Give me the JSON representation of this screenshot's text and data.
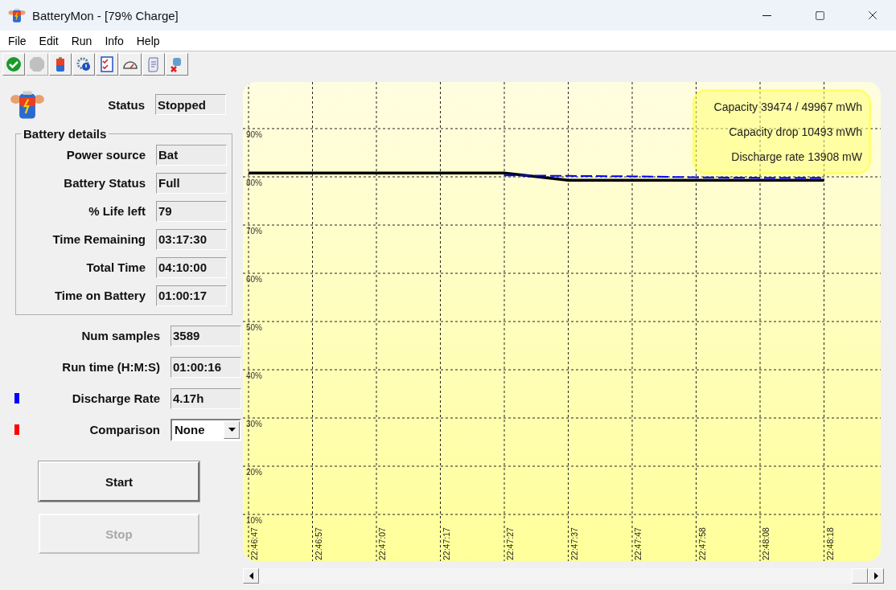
{
  "window": {
    "title": "BatteryMon - [79% Charge]"
  },
  "menu": [
    "File",
    "Edit",
    "Run",
    "Info",
    "Help"
  ],
  "toolbar": [
    {
      "kind": "start",
      "disabled": false
    },
    {
      "kind": "stop",
      "disabled": true
    },
    {
      "kind": "battery",
      "disabled": false
    },
    {
      "kind": "settings",
      "disabled": false
    },
    {
      "kind": "checklist",
      "disabled": false
    },
    {
      "kind": "gauge",
      "disabled": false
    },
    {
      "kind": "script",
      "disabled": false
    },
    {
      "kind": "tools",
      "disabled": false
    }
  ],
  "status": {
    "label": "Status",
    "value": "Stopped"
  },
  "battery_details": {
    "title": "Battery details",
    "fields": [
      {
        "label": "Power source",
        "value": "Bat"
      },
      {
        "label": "Battery Status",
        "value": "Full"
      },
      {
        "label": "% Life left",
        "value": "79"
      },
      {
        "label": "Time Remaining",
        "value": "03:17:30"
      },
      {
        "label": "Total Time",
        "value": "04:10:00"
      },
      {
        "label": "Time on Battery",
        "value": "01:00:17"
      }
    ]
  },
  "stats": [
    {
      "kind": "field",
      "label": "Num samples",
      "value": "3589"
    },
    {
      "kind": "field",
      "label": "Run time (H:M:S)",
      "value": "01:00:16"
    },
    {
      "kind": "field",
      "label": "Discharge Rate",
      "value": "4.17h",
      "color": "#0000ff"
    },
    {
      "kind": "dropdown",
      "label": "Comparison",
      "value": "None",
      "color": "#ff0000"
    }
  ],
  "buttons": [
    {
      "label": "Start",
      "disabled": false
    },
    {
      "label": "Stop",
      "disabled": true
    }
  ],
  "chart": {
    "info": [
      "Capacity 39474 / 49967 mWh",
      "Capacity drop 10493 mWh",
      "Discharge rate 13908 mW"
    ],
    "chart_data": {
      "type": "line",
      "categories": [
        "22:46:47",
        "22:46:57",
        "22:47:07",
        "22:47:17",
        "22:47:27",
        "22:47:37",
        "22:47:47",
        "22:47:58",
        "22:48:08",
        "22:48:18"
      ],
      "ylim": [
        0,
        100
      ],
      "grid": true,
      "yticks": [
        {
          "value": 10,
          "label": "10%"
        },
        {
          "value": 20,
          "label": "20%"
        },
        {
          "value": 30,
          "label": "30%"
        },
        {
          "value": 40,
          "label": "40%"
        },
        {
          "value": 50,
          "label": "50%"
        },
        {
          "value": 60,
          "label": "60%"
        },
        {
          "value": 70,
          "label": "70%"
        },
        {
          "value": 80,
          "label": "80%"
        },
        {
          "value": 90,
          "label": "90%"
        }
      ],
      "series": [
        {
          "color": "#000000",
          "line_style": "solid",
          "values": [
            80.8,
            80.8,
            80.8,
            80.8,
            80.8,
            79.3,
            79.3,
            79.3,
            79.3,
            79.3
          ]
        },
        {
          "color": "#0000ff",
          "line_style": "dashed",
          "values": [
            null,
            null,
            null,
            null,
            80.3,
            80.2,
            80.1,
            79.9,
            79.8,
            79.8
          ]
        }
      ]
    }
  }
}
